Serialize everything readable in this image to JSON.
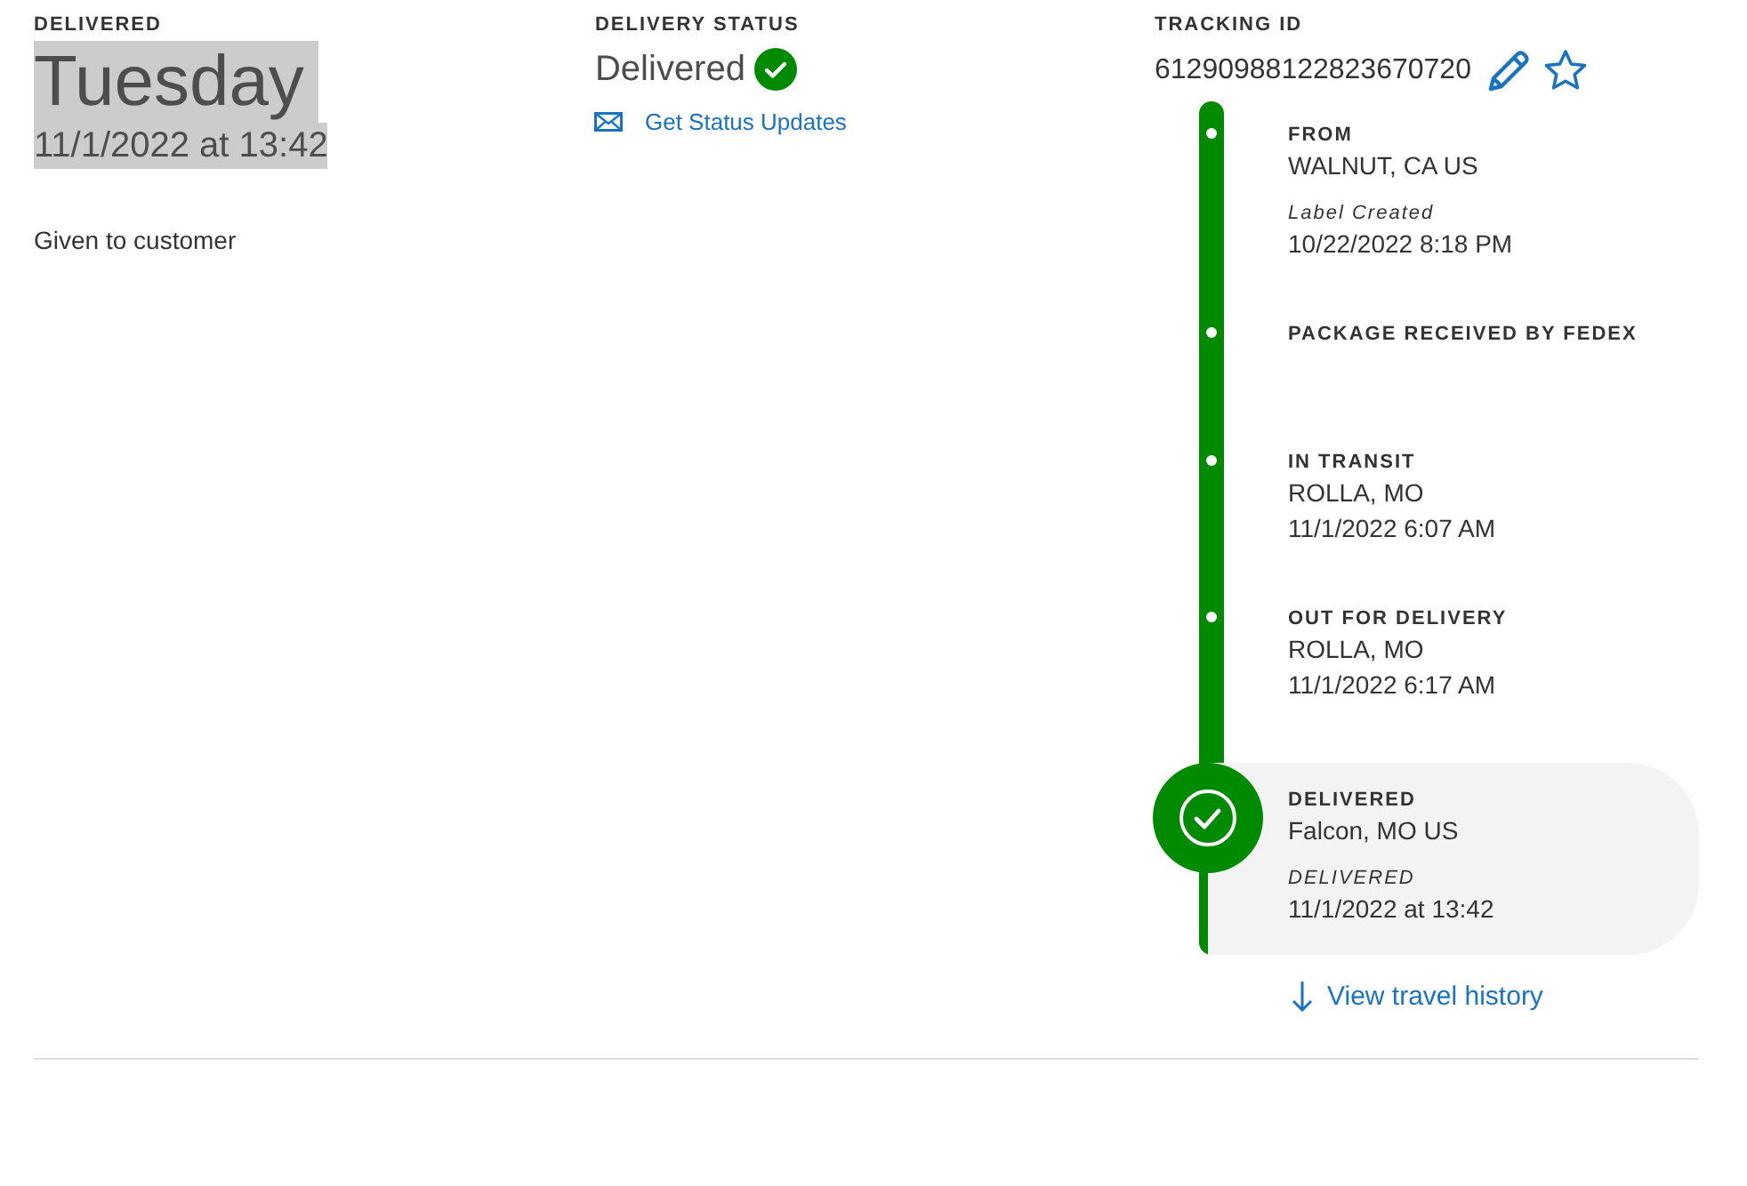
{
  "delivered": {
    "heading": "DELIVERED",
    "day": "Tuesday",
    "date": "11/1/2022 at 13:42",
    "highlighted": true,
    "note": "Given to customer"
  },
  "status": {
    "heading": "DELIVERY STATUS",
    "value": "Delivered",
    "link": "Get Status Updates"
  },
  "tracking": {
    "heading": "TRACKING ID",
    "number": "61290988122823670720"
  },
  "timeline": [
    {
      "kind": "dot",
      "current": false,
      "title": "FROM",
      "location": "WALNUT, CA US",
      "note": "Label Created",
      "time": "10/22/2022 8:18 PM"
    },
    {
      "kind": "dot",
      "current": false,
      "title": "PACKAGE RECEIVED BY FEDEX"
    },
    {
      "kind": "dot",
      "current": false,
      "title": "IN TRANSIT",
      "location": "ROLLA, MO",
      "time": "11/1/2022 6:07 AM"
    },
    {
      "kind": "dot",
      "current": false,
      "title": "OUT FOR DELIVERY",
      "location": "ROLLA, MO",
      "time": "11/1/2022 6:17 AM"
    },
    {
      "kind": "check",
      "current": true,
      "title": "DELIVERED",
      "location": "Falcon, MO US",
      "note": "DELIVERED",
      "time": "11/1/2022 at 13:42"
    }
  ],
  "history_link": "View travel history"
}
